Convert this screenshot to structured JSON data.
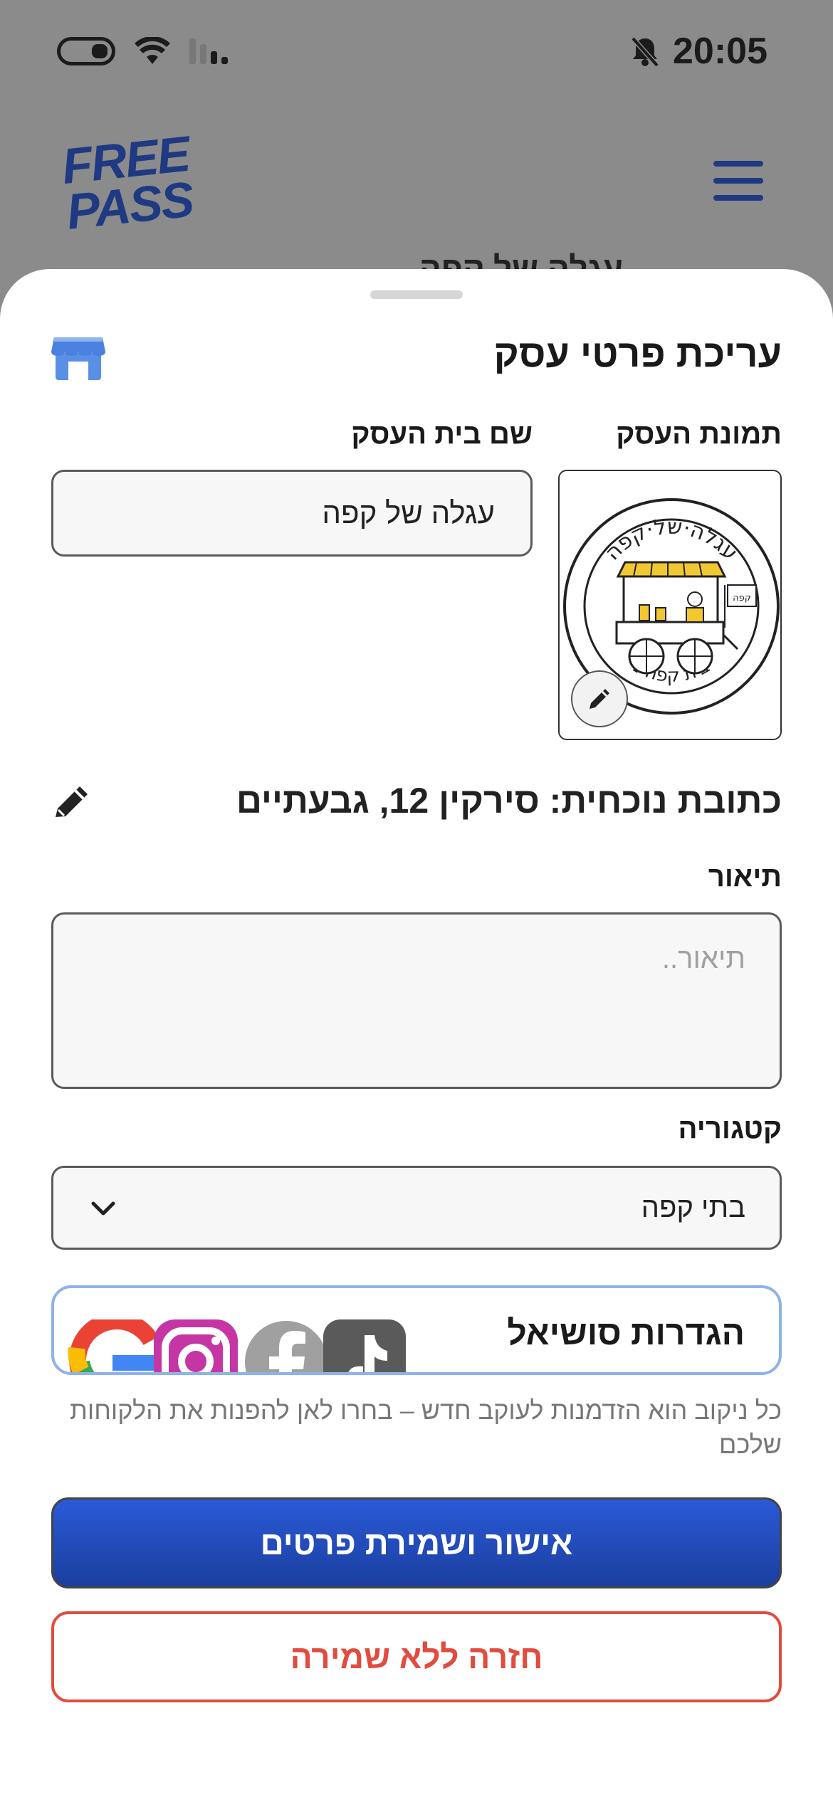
{
  "status_bar": {
    "time": "20:05",
    "icons": [
      "battery-icon",
      "wifi-icon",
      "signal-icon",
      "bell-muted-icon"
    ]
  },
  "background_app": {
    "logo_text": "FREE PASS",
    "title": "עגלה של קפה",
    "menu_icon": "hamburger-icon"
  },
  "sheet": {
    "title": "עריכת פרטי עסק",
    "title_icon": "store-icon",
    "image_label": "תמונת העסק",
    "name_label": "שם בית העסק",
    "name_value": "עגלה של קפה",
    "image_logo": {
      "top_text": "עגלה·של·קפה",
      "bottom_text": "בית קפה נ",
      "sign_text": "קפה"
    },
    "address": "כתובת נוכחית: סירקין 12, גבעתיים",
    "description_label": "תיאור",
    "description_placeholder": "תיאור..",
    "description_value": "",
    "category_label": "קטגוריה",
    "category_value": "בתי קפה",
    "social_label": "הגדרות סושיאל",
    "social_icons": [
      "google-icon",
      "instagram-icon",
      "facebook-icon",
      "tiktok-icon"
    ],
    "hint": "כל ניקוב הוא הזדמנות לעוקב חדש – בחרו לאן להפנות את הלקוחות שלכם",
    "confirm_button": "אישור ושמירת פרטים",
    "back_button": "חזרה ללא שמירה"
  },
  "colors": {
    "primary": "#2b5ad8",
    "danger": "#e14c3f",
    "brand": "#1f3a82",
    "social_border": "#8fb2e8"
  }
}
